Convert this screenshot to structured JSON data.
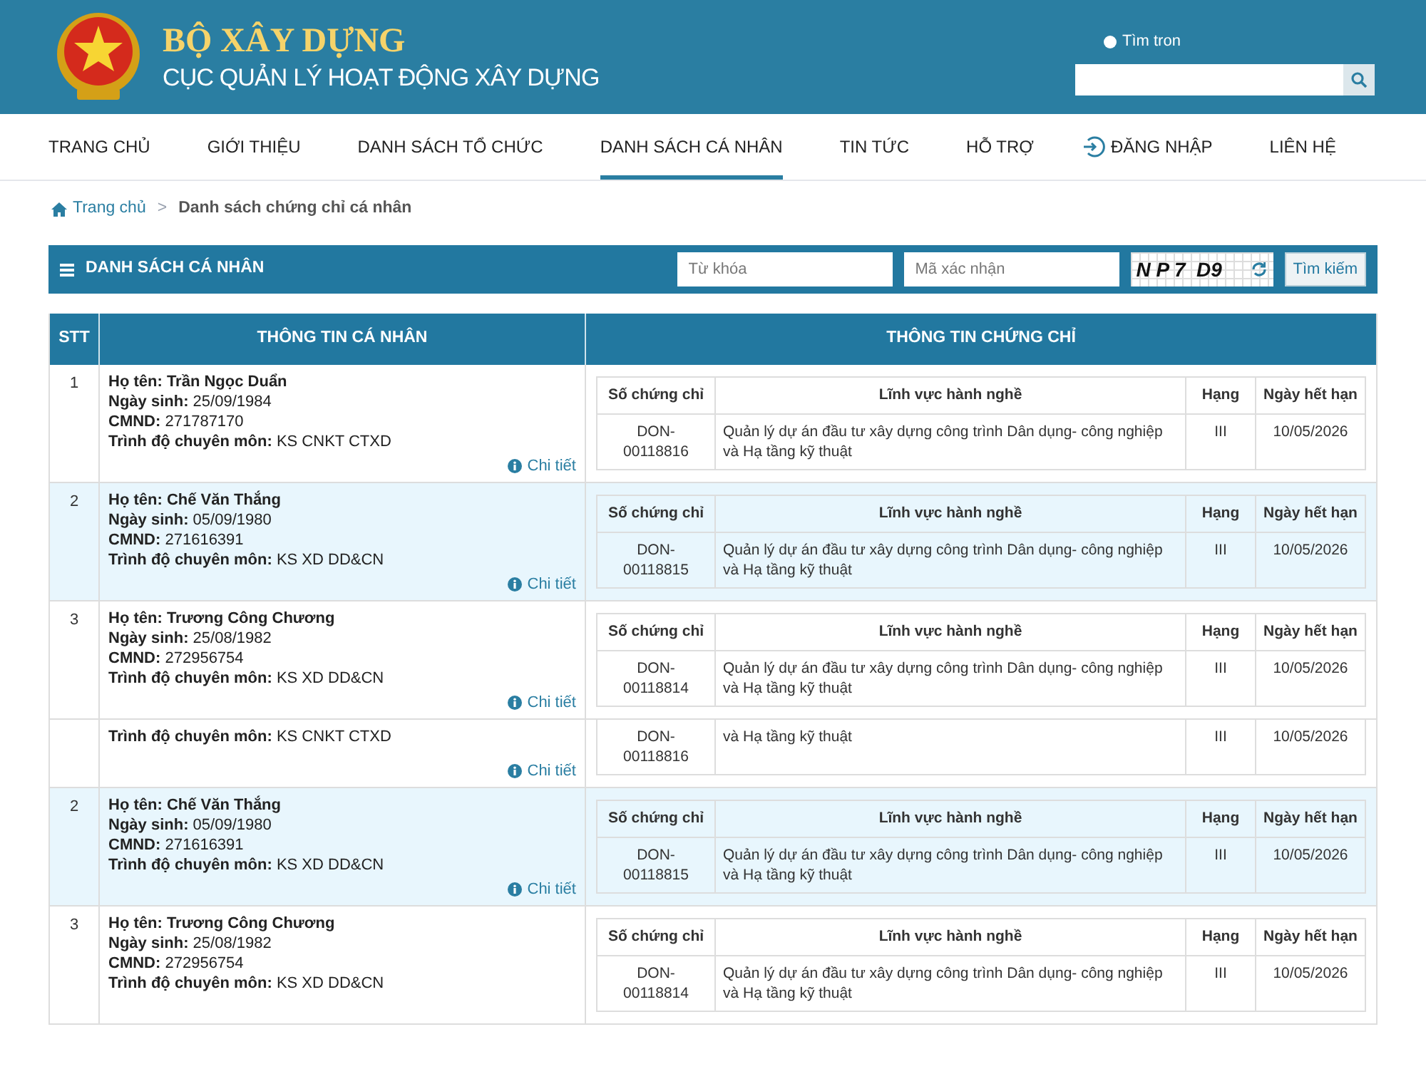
{
  "header": {
    "title": "BỘ XÂY DỰNG",
    "subtitle": "CỤC QUẢN LÝ HOẠT ĐỘNG XÂY DỰNG",
    "search_option": {
      "label": "Tìm tron",
      "selected": false
    }
  },
  "nav": [
    {
      "label": "TRANG CHỦ",
      "selected": false,
      "kind": "link"
    },
    {
      "label": "GIỚI THIỆU",
      "selected": false,
      "kind": "link"
    },
    {
      "label": "DANH SÁCH TỔ CHỨC",
      "selected": false,
      "kind": "link"
    },
    {
      "label": "DANH SÁCH CÁ NHÂN",
      "selected": true,
      "kind": "link"
    },
    {
      "label": "TIN TỨC",
      "selected": false,
      "kind": "link"
    },
    {
      "label": "HỖ TRỢ",
      "selected": false,
      "kind": "link"
    },
    {
      "label": "ĐĂNG NHẬP",
      "selected": false,
      "kind": "login"
    },
    {
      "label": "LIÊN HỆ",
      "selected": false,
      "kind": "link"
    }
  ],
  "breadcrumb": [
    "Trang chủ",
    ">",
    "Danh sách chứng chỉ cá nhân"
  ],
  "panel": {
    "title": "DANH SÁCH CÁ NHÂN",
    "keyword_placeholder": "Từ khóa",
    "captcha_placeholder": "Mã xác nhận",
    "captcha": "N P 7  D9",
    "search_button": "Tìm kiếm"
  },
  "table": {
    "columns": [
      "STT",
      "THÔNG TIN CÁ NHÂN",
      "THÔNG TIN CHỨNG CHỈ"
    ],
    "rows": [
      {
        "stt": "1",
        "highlighted": false,
        "info": [
          {
            "kind": "name",
            "text": "Họ tên: Trần Ngọc Duẩn"
          },
          {
            "kind": "field",
            "text": "**Ngày sinh:** 25/09/1984"
          },
          {
            "kind": "field",
            "text": "**CMND:** 271787170"
          },
          {
            "kind": "field",
            "text": "**Trình độ chuyên môn:** KS CNKT CTXD"
          }
        ],
        "detail": "Chi tiết",
        "cert": {
          "columns": [
            "Số chứng chỉ",
            "Lĩnh vực hành nghề",
            "Hạng",
            "Ngày hết hạn"
          ],
          "cells": [
            "DON-00118816",
            "Quản lý dự án đầu tư xây dựng công trình Dân dụng- công nghiệp và Hạ tầng kỹ thuật",
            "III",
            "10/05/2026"
          ]
        }
      },
      {
        "stt": "2",
        "highlighted": true,
        "info": [
          {
            "kind": "name",
            "text": "Họ tên: Chế Văn Thắng"
          },
          {
            "kind": "field",
            "text": "**Ngày sinh:** 05/09/1980"
          },
          {
            "kind": "field",
            "text": "**CMND:** 271616391"
          },
          {
            "kind": "field",
            "text": "**Trình độ chuyên môn:** KS XD DD&CN"
          }
        ],
        "detail": "Chi tiết",
        "cert": {
          "columns": [
            "Số chứng chỉ",
            "Lĩnh vực hành nghề",
            "Hạng",
            "Ngày hết hạn"
          ],
          "cells": [
            "DON-00118815",
            "Quản lý dự án đầu tư xây dựng công trình Dân dụng- công nghiệp và Hạ tầng kỹ thuật",
            "III",
            "10/05/2026"
          ]
        }
      },
      {
        "stt": "3",
        "highlighted": false,
        "info": [
          {
            "kind": "name",
            "text": "Họ tên: Trương Công Chương"
          },
          {
            "kind": "field",
            "text": "**Ngày sinh:** 25/08/1982"
          },
          {
            "kind": "field",
            "text": "**CMND:** 272956754"
          },
          {
            "kind": "field",
            "text": "**Trình độ chuyên môn:** KS XD DD&CN"
          }
        ],
        "detail": "Chi tiết",
        "cert": {
          "columns": [
            "Số chứng chỉ",
            "Lĩnh vực hành nghề",
            "Hạng",
            "Ngày hết hạn"
          ],
          "cells": [
            "DON-00118814",
            "Quản lý dự án đầu tư xây dựng công trình Dân dụng- công nghiệp và Hạ tầng kỹ thuật",
            "III",
            "10/05/2026"
          ]
        }
      },
      {
        "highlighted": false,
        "info": [
          {
            "kind": "field",
            "text": "**Trình độ chuyên môn:** KS CNKT CTXD"
          }
        ],
        "detail": "Chi tiết",
        "cert": {
          "cells": [
            "DON-00118816",
            "và Hạ tầng kỹ thuật",
            "III",
            "10/05/2026"
          ]
        }
      },
      {
        "stt": "2",
        "highlighted": true,
        "info": [
          {
            "kind": "name",
            "text": "Họ tên: Chế Văn Thắng"
          },
          {
            "kind": "field",
            "text": "**Ngày sinh:** 05/09/1980"
          },
          {
            "kind": "field",
            "text": "**CMND:** 271616391"
          },
          {
            "kind": "field",
            "text": "**Trình độ chuyên môn:** KS XD DD&CN"
          }
        ],
        "detail": "Chi tiết",
        "cert": {
          "columns": [
            "Số chứng chỉ",
            "Lĩnh vực hành nghề",
            "Hạng",
            "Ngày hết hạn"
          ],
          "cells": [
            "DON-00118815",
            "Quản lý dự án đầu tư xây dựng công trình Dân dụng- công nghiệp và Hạ tầng kỹ thuật",
            "III",
            "10/05/2026"
          ]
        }
      },
      {
        "stt": "3",
        "highlighted": false,
        "info": [
          {
            "kind": "name",
            "text": "Họ tên: Trương Công Chương"
          },
          {
            "kind": "field",
            "text": "**Ngày sinh:** 25/08/1982"
          },
          {
            "kind": "field",
            "text": "**CMND:** 272956754"
          },
          {
            "kind": "field",
            "text": "**Trình độ chuyên môn:** KS XD DD&CN"
          }
        ],
        "cert": {
          "columns": [
            "Số chứng chỉ",
            "Lĩnh vực hành nghề",
            "Hạng",
            "Ngày hết hạn"
          ],
          "cells": [
            "DON-00118814",
            "Quản lý dự án đầu tư xây dựng công trình Dân dụng- công nghiệp và Hạ tầng kỹ thuật",
            "III",
            "10/05/2026"
          ]
        }
      }
    ]
  }
}
